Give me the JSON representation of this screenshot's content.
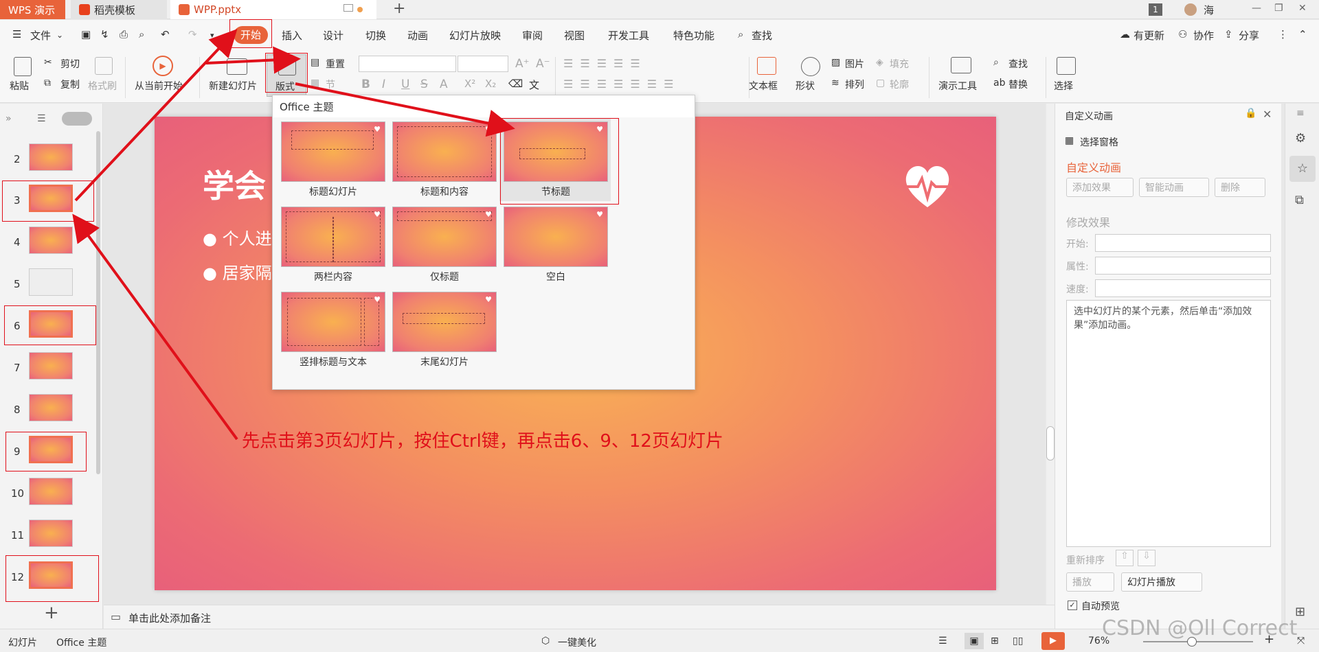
{
  "tabs": {
    "wps": "WPS 演示",
    "daoke": "稻壳模板",
    "file": "WPP.pptx",
    "page_badge": "1",
    "user": "海"
  },
  "menu": {
    "file": "文件",
    "items": [
      "开始",
      "插入",
      "设计",
      "切换",
      "动画",
      "幻灯片放映",
      "审阅",
      "视图",
      "开发工具",
      "特色功能"
    ],
    "search": "查找",
    "right": [
      "有更新",
      "协作",
      "分享"
    ]
  },
  "ribbon": {
    "paste": "粘贴",
    "cut": "剪切",
    "copy": "复制",
    "format_painter": "格式刷",
    "from_current": "从当前开始",
    "new_slide": "新建幻灯片",
    "layout": "版式",
    "reset": "重置",
    "section": "节",
    "textbox": "文本框",
    "shape": "形状",
    "arrange": "排列",
    "picture": "图片",
    "fill": "填充",
    "outline": "轮廓",
    "present_tools": "演示工具",
    "find": "查找",
    "replace": "替换",
    "select": "选择"
  },
  "thumbs": [
    {
      "num": "2"
    },
    {
      "num": "3"
    },
    {
      "num": "4"
    },
    {
      "num": "5"
    },
    {
      "num": "6"
    },
    {
      "num": "7"
    },
    {
      "num": "8"
    },
    {
      "num": "9"
    },
    {
      "num": "10"
    },
    {
      "num": "11"
    },
    {
      "num": "12"
    }
  ],
  "slide": {
    "title": "学会",
    "bullets": [
      "个人进行",
      "居家隔离"
    ]
  },
  "dropdown": {
    "title": "Office 主题",
    "layouts": [
      "标题幻灯片",
      "标题和内容",
      "节标题",
      "两栏内容",
      "仅标题",
      "空白",
      "竖排标题与文本",
      "末尾幻灯片"
    ]
  },
  "annotation": "先点击第3页幻灯片，按住Ctrl键，再点击6、9、12页幻灯片",
  "rightpanel": {
    "header": "自定义动画",
    "selection_pane": "选择窗格",
    "section_title": "自定义动画",
    "add_effect": "添加效果",
    "smart_anim": "智能动画",
    "delete": "删除",
    "modify": "修改效果",
    "start": "开始:",
    "property": "属性:",
    "speed": "速度:",
    "hint": "选中幻灯片的某个元素，然后单击“添加效果”添加动画。",
    "reorder": "重新排序",
    "play": "播放",
    "slideshow": "幻灯片播放",
    "autopreview": "自动预览"
  },
  "notes": {
    "placeholder": "单击此处添加备注"
  },
  "status": {
    "slide": "幻灯片",
    "theme": "Office 主题",
    "beautify": "一键美化",
    "zoom": "76%"
  },
  "watermark": "CSDN @Oll Correct",
  "colors": {
    "accent": "#e8633a",
    "annotation": "#e0101a"
  }
}
